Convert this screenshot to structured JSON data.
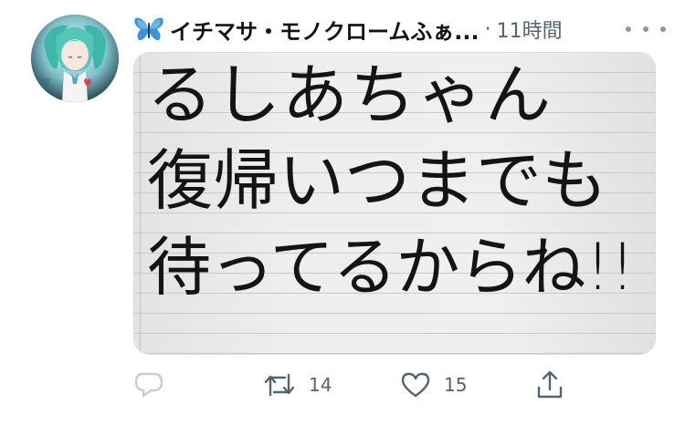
{
  "tweet": {
    "author": {
      "emoji_icon": "butterfly-emoji",
      "display_name": "イチマサ・モノクロームふぁ...",
      "avatar_icon": "avatar-image"
    },
    "separator": "·",
    "time": "11時間",
    "more_icon": "more-options-icon",
    "media": {
      "lines": [
        "るしあちゃん",
        "復帰いつまでも",
        "待ってるからね!!"
      ]
    },
    "actions": {
      "reply_icon": "reply-icon",
      "retweet_icon": "retweet-icon",
      "retweet_count": "14",
      "like_icon": "like-icon",
      "like_count": "15",
      "share_icon": "share-icon"
    }
  },
  "colors": {
    "text_primary": "#0f1419",
    "text_secondary": "#536471",
    "paper": "#efeeec",
    "butterfly": "#3b94d9"
  }
}
